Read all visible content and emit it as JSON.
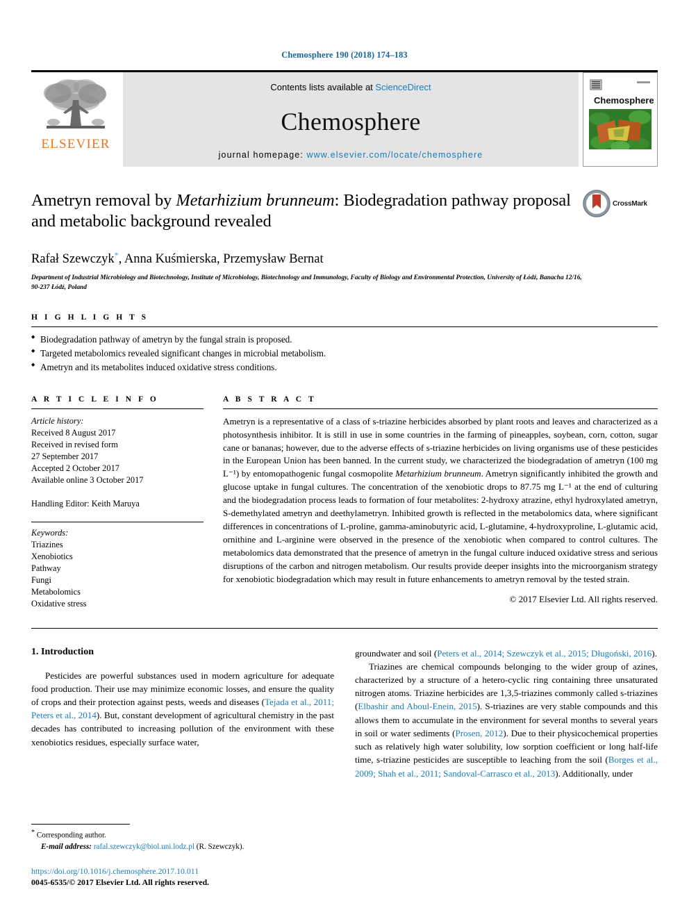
{
  "running_head": "Chemosphere 190 (2018) 174–183",
  "masthead": {
    "publisher_name": "ELSEVIER",
    "contents_prefix": "Contents lists available at ",
    "contents_link": "ScienceDirect",
    "journal_name": "Chemosphere",
    "homepage_prefix": "journal homepage: ",
    "homepage_link": "www.elsevier.com/locate/chemosphere",
    "cover_title": "Chemosphere"
  },
  "article": {
    "title_part1": "Ametryn removal by ",
    "title_italic": "Metarhizium brunneum",
    "title_part2": ": Biodegradation pathway proposal and metabolic background revealed",
    "crossmark_label": "CrossMark",
    "authors": "Rafał Szewczyk",
    "authors_rest": ", Anna Kuśmierska, Przemysław Bernat",
    "corresponding_marker": "*",
    "affiliation": "Department of Industrial Microbiology and Biotechnology, Institute of Microbiology, Biotechnology and Immunology, Faculty of Biology and Environmental Protection, University of Łódź, Banacha 12/16, 90-237 Łódź, Poland"
  },
  "highlights": {
    "heading": "H I G H L I G H T S",
    "items": [
      "Biodegradation pathway of ametryn by the fungal strain is proposed.",
      "Targeted metabolomics revealed significant changes in microbial metabolism.",
      "Ametryn and its metabolites induced oxidative stress conditions."
    ]
  },
  "article_info": {
    "heading": "A R T I C L E  I N F O",
    "history_label": "Article history:",
    "history": [
      "Received 8 August 2017",
      "Received in revised form",
      "27 September 2017",
      "Accepted 2 October 2017",
      "Available online 3 October 2017"
    ],
    "handling_editor": "Handling Editor: Keith Maruya",
    "keywords_label": "Keywords:",
    "keywords": [
      "Triazines",
      "Xenobiotics",
      "Pathway",
      "Fungi",
      "Metabolomics",
      "Oxidative stress"
    ]
  },
  "abstract": {
    "heading": "A B S T R A C T",
    "p1": "Ametryn is a representative of a class of s-triazine herbicides absorbed by plant roots and leaves and characterized as a photosynthesis inhibitor. It is still in use in some countries in the farming of pineapples, soybean, corn, cotton, sugar cane or bananas; however, due to the adverse effects of s-triazine herbicides on living organisms use of these pesticides in the European Union has been banned. In the current study, we characterized the biodegradation of ametryn (100 mg L⁻¹) by entomopathogenic fungal cosmopolite ",
    "organism": "Metarhizium brunneum",
    "p2": ". Ametryn significantly inhibited the growth and glucose uptake in fungal cultures. The concentration of the xenobiotic drops to 87.75 mg L⁻¹ at the end of culturing and the biodegradation process leads to formation of four metabolites: 2-hydroxy atrazine, ethyl hydroxylated ametryn, S-demethylated ametryn and deethylametryn. Inhibited growth is reflected in the metabolomics data, where significant differences in concentrations of L-proline, gamma-aminobutyric acid, L-glutamine, 4-hydroxyproline, L-glutamic acid, ornithine and L-arginine were observed in the presence of the xenobiotic when compared to control cultures. The metabolomics data demonstrated that the presence of ametryn in the fungal culture induced oxidative stress and serious disruptions of the carbon and nitrogen metabolism. Our results provide deeper insights into the microorganism strategy for xenobiotic biodegradation which may result in future enhancements to ametryn removal by the tested strain.",
    "copyright": "© 2017 Elsevier Ltd. All rights reserved."
  },
  "body": {
    "section_number_title": "1. Introduction",
    "left_p1_a": "Pesticides are powerful substances used in modern agriculture for adequate food production. Their use may minimize economic losses, and ensure the quality of crops and their protection against pests, weeds and diseases (",
    "left_p1_cite1": "Tejada et al., 2011; Peters et al., 2014",
    "left_p1_b": "). But, constant development of agricultural chemistry in the past decades has contributed to increasing pollution of the environment with these xenobiotics residues, especially surface water,",
    "right_p1_a": "groundwater and soil (",
    "right_p1_cite1": "Peters et al., 2014; Szewczyk et al., 2015; Długoński, 2016",
    "right_p1_b": ").",
    "right_p2_a": "Triazines are chemical compounds belonging to the wider group of azines, characterized by a structure of a hetero-cyclic ring containing three unsaturated nitrogen atoms. Triazine herbicides are 1,3,5-triazines commonly called s-triazines (",
    "right_p2_cite1": "Elbashir and Aboul-Enein, 2015",
    "right_p2_b": "). S-triazines are very stable compounds and this allows them to accumulate in the environment for several months to several years in soil or water sediments (",
    "right_p2_cite2": "Prosen, 2012",
    "right_p2_c": "). Due to their physicochemical properties such as relatively high water solubility, low sorption coefficient or long half-life time, s-triazine pesticides are susceptible to leaching from the soil (",
    "right_p2_cite3": "Borges et al., 2009; Shah et al., 2011; Sandoval-Carrasco et al., 2013",
    "right_p2_d": "). Additionally, under"
  },
  "footnote": {
    "corresponding_star": "*",
    "corresponding_text": " Corresponding author.",
    "email_label": "E-mail address: ",
    "email": "rafal.szewczyk@biol.uni.lodz.pl",
    "email_suffix": " (R. Szewczyk).",
    "doi": "https://doi.org/10.1016/j.chemosphere.2017.10.011",
    "issn": "0045-6535/© 2017 Elsevier Ltd. All rights reserved."
  },
  "colors": {
    "link_blue": "#1a7bb9",
    "elsevier_orange": "#E87722",
    "masthead_grey": "#e4e4e4"
  }
}
